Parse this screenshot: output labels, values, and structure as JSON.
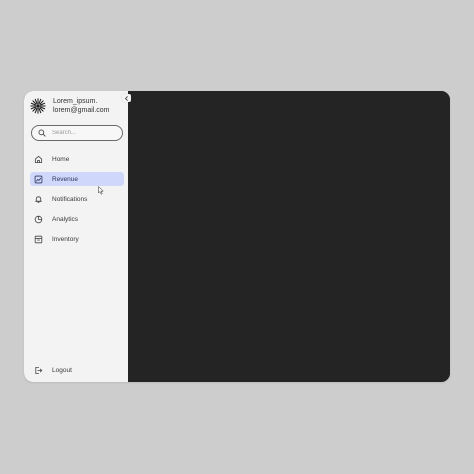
{
  "profile": {
    "name": "Lorem_ipsum.",
    "email": "lorem@gmail.com",
    "avatar_icon": "sunburst-logo-icon"
  },
  "search": {
    "placeholder": "Search..."
  },
  "nav": {
    "items": [
      {
        "label": "Home",
        "icon": "home-icon",
        "active": false
      },
      {
        "label": "Revenue",
        "icon": "chart-icon",
        "active": true
      },
      {
        "label": "Notifications",
        "icon": "bell-icon",
        "active": false
      },
      {
        "label": "Analytics",
        "icon": "pie-chart-icon",
        "active": false
      },
      {
        "label": "Inventory",
        "icon": "box-icon",
        "active": false
      }
    ],
    "logout_label": "Logout"
  },
  "colors": {
    "background": "#cdcdcd",
    "sidebar": "#f3f3f3",
    "content": "#242424",
    "active": "#cfd8fb"
  }
}
